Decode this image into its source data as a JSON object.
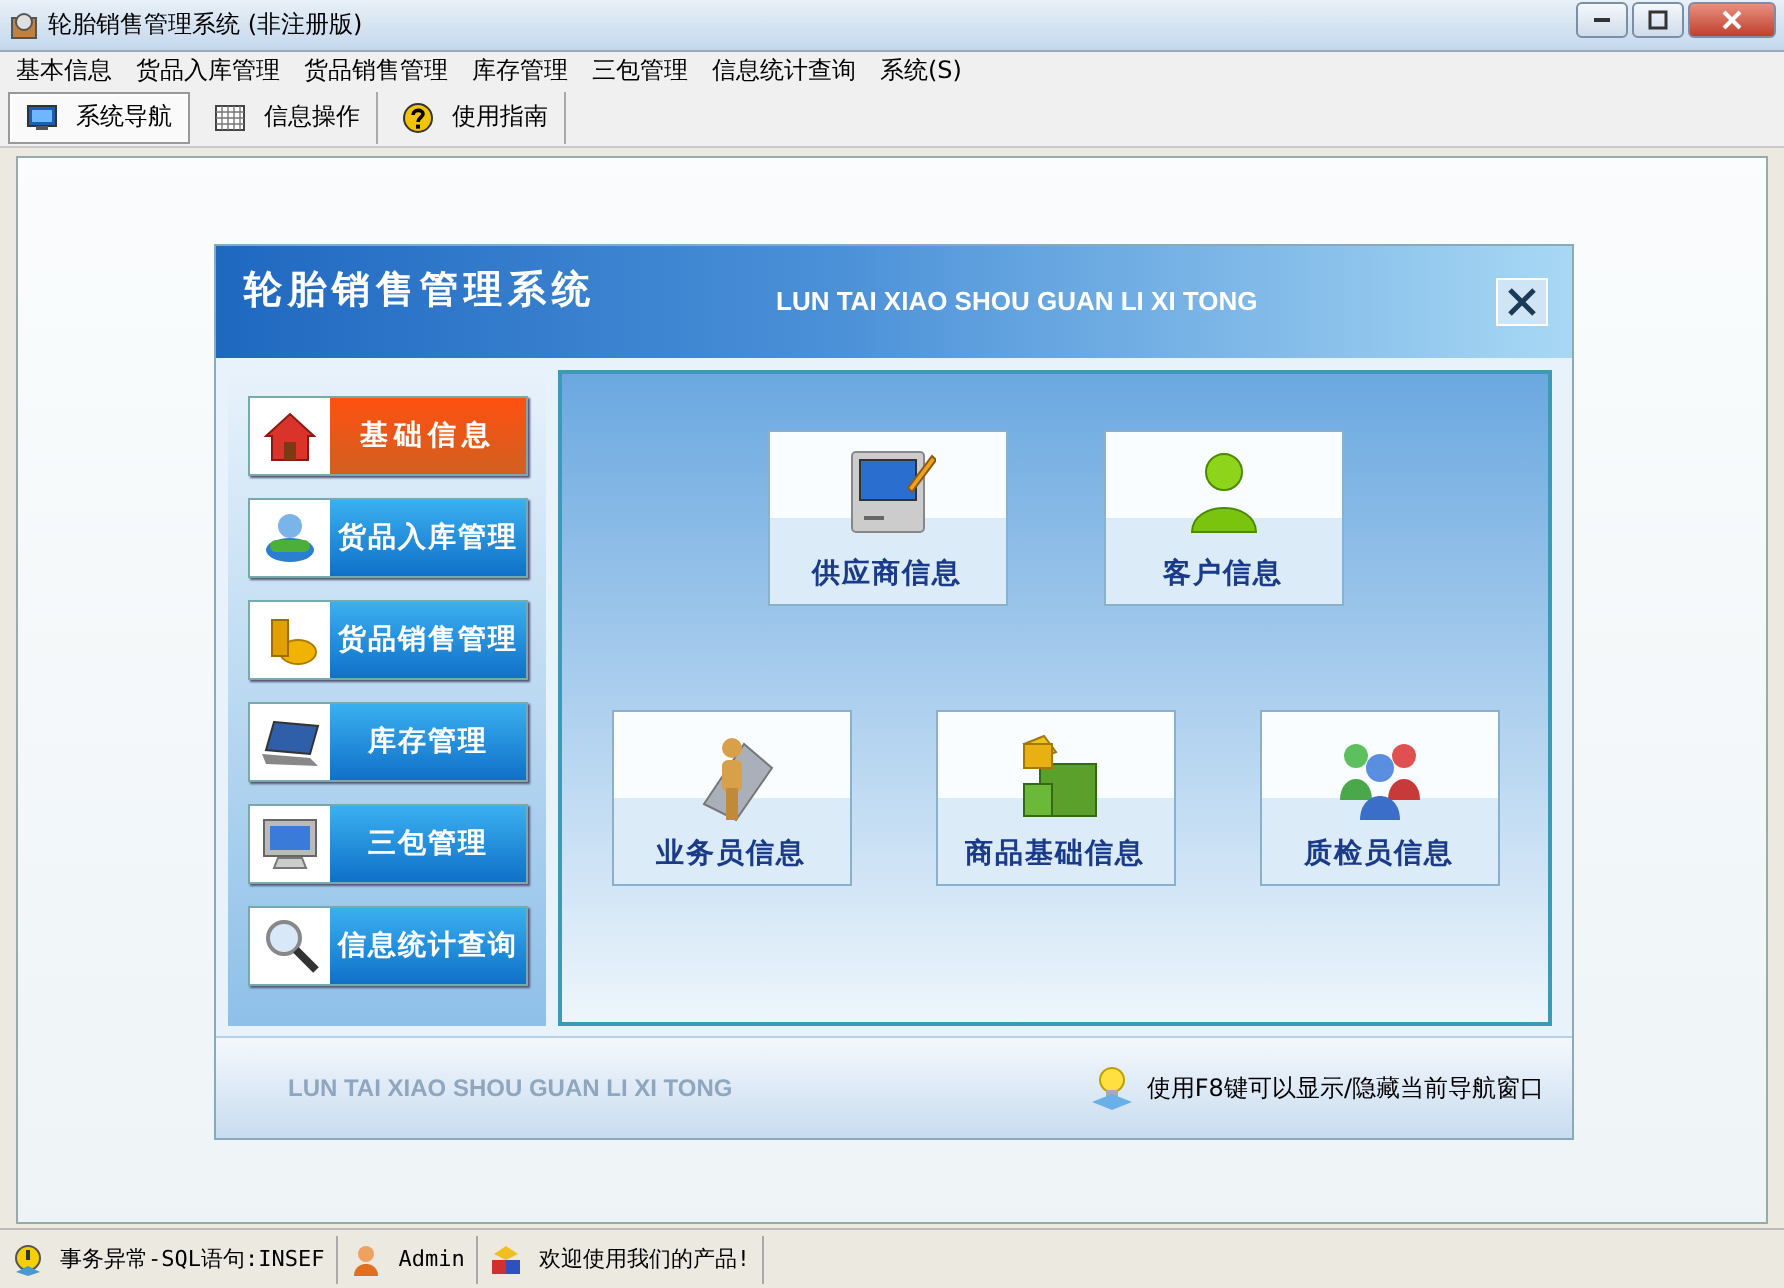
{
  "window": {
    "title": "轮胎销售管理系统 (非注册版)"
  },
  "menu": [
    "基本信息",
    "货品入库管理",
    "货品销售管理",
    "库存管理",
    "三包管理",
    "信息统计查询",
    "系统(S)"
  ],
  "toolbar": [
    {
      "label": "系统导航",
      "kind": "monitor",
      "selected": true
    },
    {
      "label": "信息操作",
      "kind": "grid",
      "selected": false
    },
    {
      "label": "使用指南",
      "kind": "help",
      "selected": false
    }
  ],
  "panel": {
    "title": "轮胎销售管理系统",
    "subtitle": "LUN TAI XIAO SHOU GUAN LI XI TONG",
    "footer_mark": "LUN TAI XIAO SHOU GUAN LI XI TONG",
    "hint": "使用F8键可以显示/隐藏当前导航窗口"
  },
  "sidebar": {
    "items": [
      {
        "label": "基础信息",
        "kind": "house",
        "selected": true
      },
      {
        "label": "货品入库管理",
        "kind": "person",
        "selected": false
      },
      {
        "label": "货品销售管理",
        "kind": "coins",
        "selected": false
      },
      {
        "label": "库存管理",
        "kind": "laptop",
        "selected": false
      },
      {
        "label": "三包管理",
        "kind": "monitor",
        "selected": false
      },
      {
        "label": "信息统计查询",
        "kind": "magnifier",
        "selected": false
      }
    ]
  },
  "tiles": [
    [
      {
        "label": "供应商信息",
        "kind": "computer"
      },
      {
        "label": "客户信息",
        "kind": "user"
      }
    ],
    [
      {
        "label": "业务员信息",
        "kind": "figure"
      },
      {
        "label": "商品基础信息",
        "kind": "cubes"
      },
      {
        "label": "质检员信息",
        "kind": "group"
      }
    ]
  ],
  "status_bar": [
    {
      "text": "事务异常-SQL语句:INSEF",
      "kind": "alert"
    },
    {
      "text": "Admin",
      "kind": "user"
    },
    {
      "text": "欢迎使用我们的产品!",
      "kind": "shapes"
    }
  ]
}
